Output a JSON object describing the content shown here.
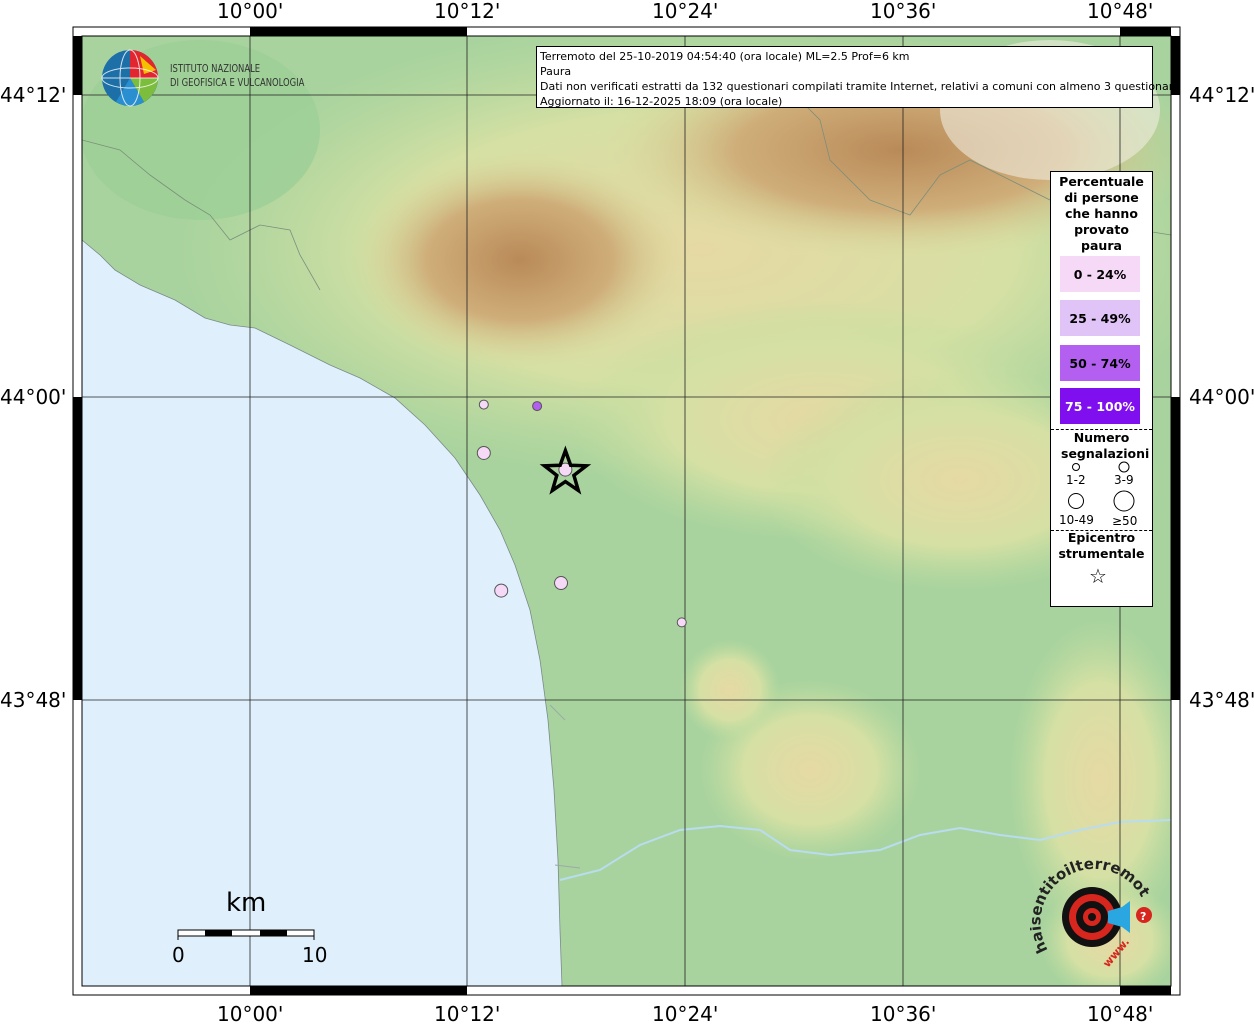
{
  "info": {
    "line1": "Terremoto del 25-10-2019 04:54:40 (ora locale) ML=2.5 Prof=6 km",
    "line2": "Paura",
    "line3": "Dati non verificati estratti da 132 questionari compilati tramite Internet, relativi a comuni con almeno 3 questionari.",
    "line4": "Aggiornato il: 16-12-2025 18:09 (ora locale)"
  },
  "axes": {
    "lon_labels": [
      "10°00'",
      "10°12'",
      "10°24'",
      "10°36'",
      "10°48'"
    ],
    "lat_labels": [
      "44°12'",
      "44°00'",
      "43°48'"
    ]
  },
  "logo": {
    "name_line1": "ISTITUTO NAZIONALE",
    "name_line2": "DI GEOFISICA E VULCANOLOGIA"
  },
  "legend": {
    "title": "Percentuale di persone che hanno provato paura",
    "classes": [
      {
        "label": "0 - 24%",
        "color": "#f5d9f7"
      },
      {
        "label": "25 - 49%",
        "color": "#e1c4f7"
      },
      {
        "label": "50 - 74%",
        "color": "#b35ff0"
      },
      {
        "label": "75 - 100%",
        "color": "#7f0fef"
      }
    ],
    "count_title": "Numero segnalazioni",
    "counts": [
      "1-2",
      "3-9",
      "10-49",
      "≥50"
    ],
    "epicenter_title": "Epicentro strumentale",
    "star_glyph": "☆"
  },
  "scale": {
    "unit": "km",
    "min": "0",
    "max": "10"
  },
  "hsn_logo": {
    "text": "haisentitoilterremoto.it",
    "www": "www.",
    "colors": {
      "red": "#d7261e",
      "blue": "#2aa7e0"
    }
  },
  "colors": {
    "sea": "#dff0fc",
    "plain": "#a8d5a0",
    "hill": "#d9dfa2",
    "mountain": "#c89f6a"
  },
  "chart_data": {
    "type": "scatter",
    "epicenter": {
      "lon": 10.29,
      "lat": 43.95
    },
    "points": [
      {
        "lon": 10.215,
        "lat": 43.995,
        "class": "0 - 24%",
        "count": "1-2"
      },
      {
        "lon": 10.264,
        "lat": 43.994,
        "class": "50 - 74%",
        "count": "1-2"
      },
      {
        "lon": 10.215,
        "lat": 43.963,
        "class": "0 - 24%",
        "count": "3-9"
      },
      {
        "lon": 10.29,
        "lat": 43.952,
        "class": "0 - 24%",
        "count": "3-9"
      },
      {
        "lon": 10.286,
        "lat": 43.877,
        "class": "0 - 24%",
        "count": "3-9"
      },
      {
        "lon": 10.231,
        "lat": 43.872,
        "class": "0 - 24%",
        "count": "3-9"
      },
      {
        "lon": 10.397,
        "lat": 43.851,
        "class": "0 - 24%",
        "count": "1-2"
      }
    ],
    "xlim": [
      9.905,
      10.84
    ],
    "ylim": [
      43.64,
      44.23
    ]
  }
}
